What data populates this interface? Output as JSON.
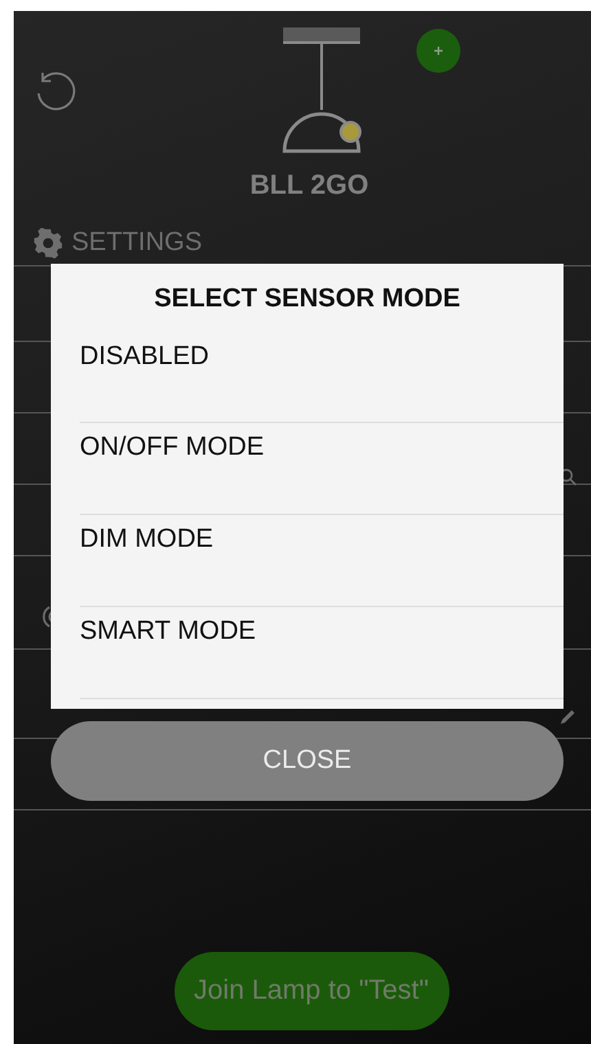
{
  "device": {
    "name": "BLL 2GO"
  },
  "settings": {
    "title": "SETTINGS",
    "rows": [
      {
        "kind": "blank"
      },
      {
        "kind": "blank"
      },
      {
        "kind": "search"
      },
      {
        "kind": "blank"
      },
      {
        "kind": "sensor"
      },
      {
        "kind": "mode"
      },
      {
        "kind": "blank"
      }
    ]
  },
  "dialog": {
    "title": "SELECT SENSOR MODE",
    "options": [
      "DISABLED",
      "ON/OFF MODE",
      "DIM MODE",
      "SMART MODE"
    ],
    "close": "CLOSE"
  },
  "join_button": "Join Lamp to \"Test\""
}
